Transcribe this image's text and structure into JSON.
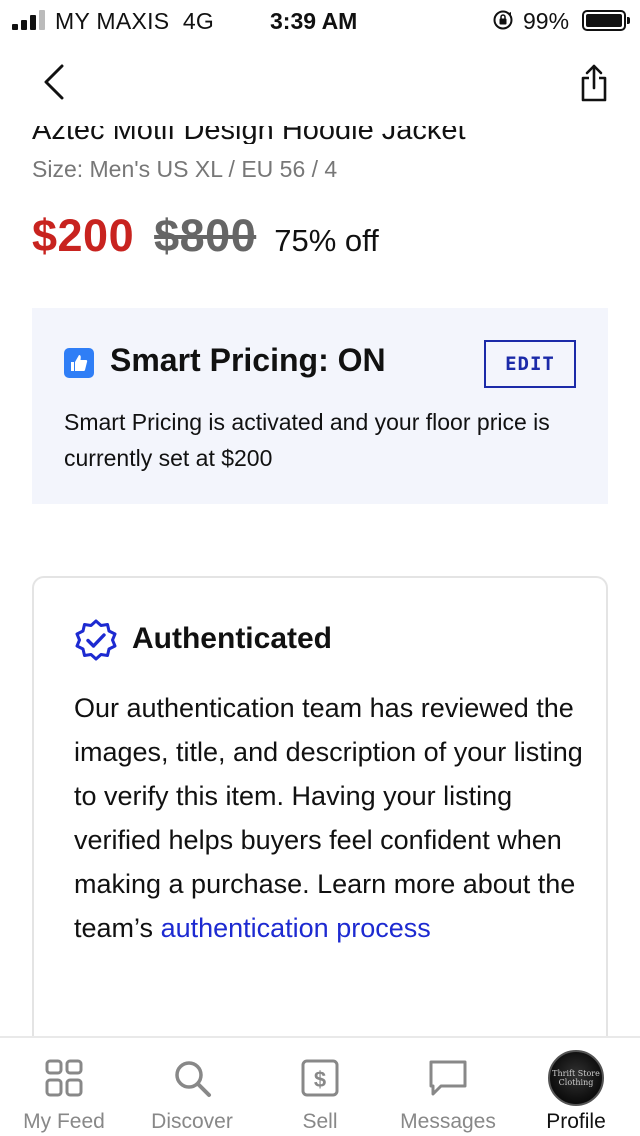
{
  "status_bar": {
    "carrier": "MY MAXIS",
    "network": "4G",
    "time": "3:39 AM",
    "battery_percent": "99%",
    "signal_bars": 3
  },
  "nav": {
    "back_icon": "chevron-left-icon",
    "share_icon": "share-icon"
  },
  "product": {
    "title": "Aztec Motif Design Hoodie Jacket",
    "size": "Size: Men's US XL / EU 56 / 4",
    "price_current": "$200",
    "price_original": "$800",
    "discount": "75% off"
  },
  "smart_pricing": {
    "icon": "thumbs-up-icon",
    "title": "Smart Pricing: ON",
    "edit_label": "EDIT",
    "description": "Smart Pricing is activated and your floor price is currently set at $200",
    "accent_color": "#1b2aa8"
  },
  "authenticated": {
    "icon": "verified-badge-icon",
    "title": "Authenticated",
    "body": "Our authentication team has reviewed the images, title, and description of your listing to verify this item. Having your listing verified helps buyers feel confident when making a purchase. Learn more about the team’s",
    "link_text": "authentication process",
    "link_color": "#1d2ad1"
  },
  "tab_bar": {
    "tabs": [
      {
        "label": "My Feed",
        "icon": "feed-grid-icon",
        "active": false
      },
      {
        "label": "Discover",
        "icon": "search-icon",
        "active": false
      },
      {
        "label": "Sell",
        "icon": "dollar-tag-icon",
        "active": false
      },
      {
        "label": "Messages",
        "icon": "chat-bubble-icon",
        "active": false
      },
      {
        "label": "Profile",
        "icon": "avatar",
        "active": true
      }
    ],
    "profile_avatar_text": "Thrift Store Clothing"
  },
  "colors": {
    "price_red": "#c8231f",
    "smart_box_bg": "#f3f5fc",
    "thumb_blue": "#2f7ef6"
  }
}
